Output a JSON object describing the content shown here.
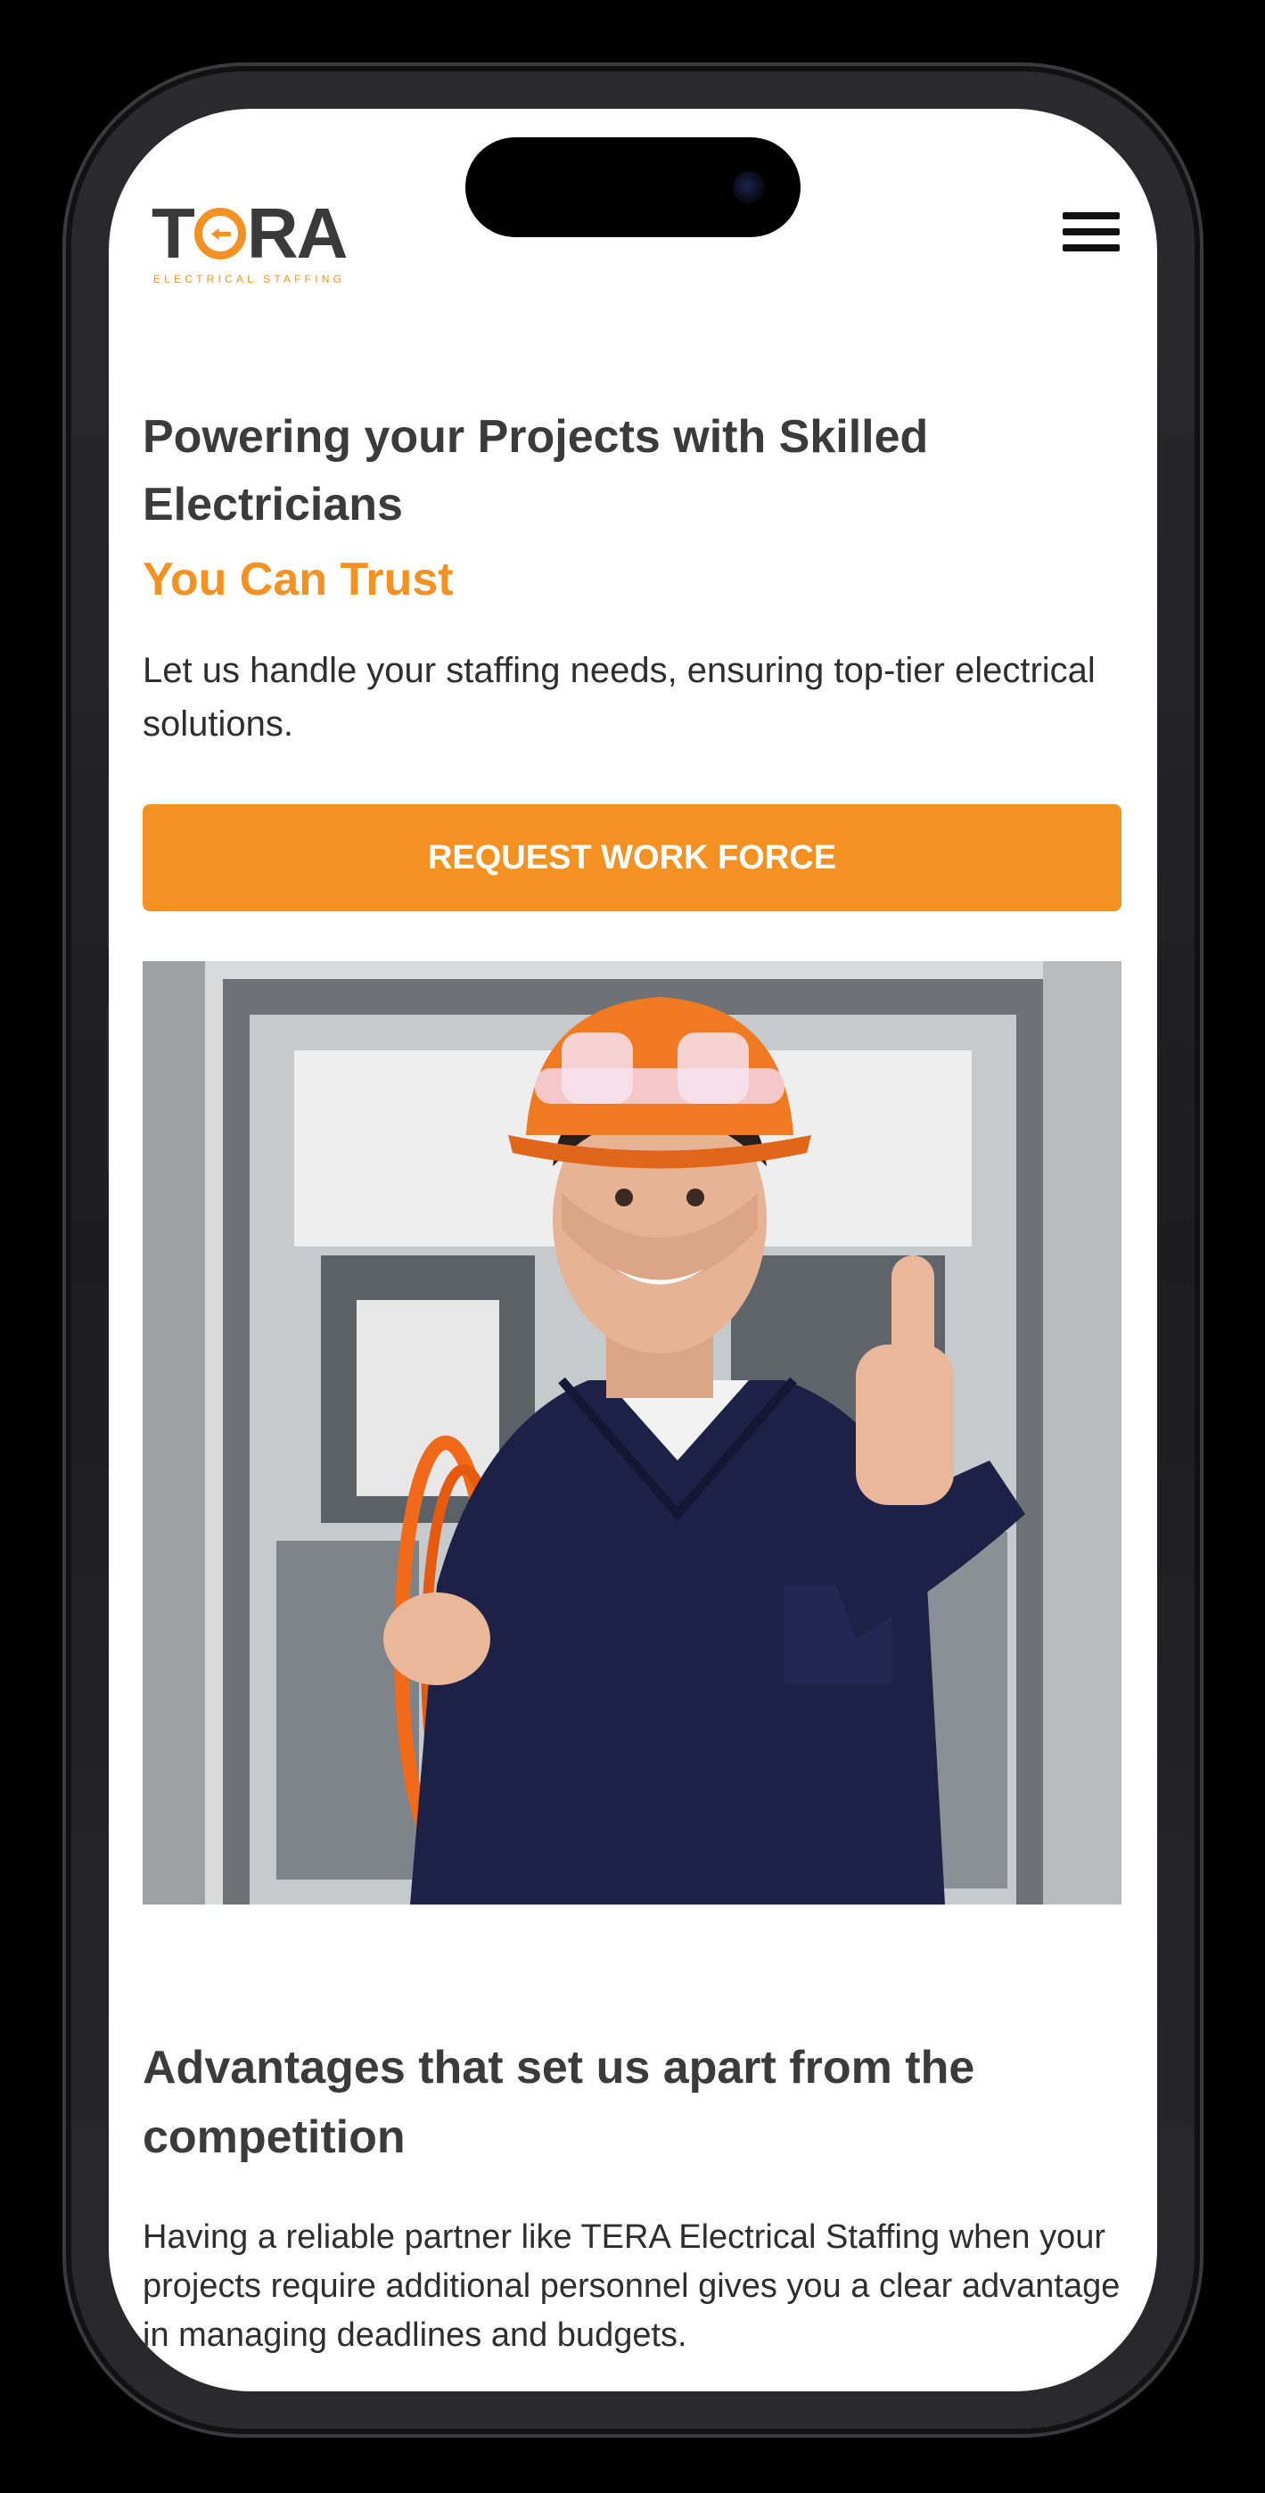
{
  "header": {
    "logo_wordmark_1": "T",
    "logo_wordmark_2": "RA",
    "logo_tagline": "ELECTRICAL STAFFING",
    "menu_icon": "hamburger-menu-icon"
  },
  "hero": {
    "title": "Powering your Projects with Skilled Electricians",
    "subtitle": "You Can Trust",
    "description": "Let us handle your staffing needs, ensuring top-tier electrical solutions.",
    "cta_label": "REQUEST WORK FORCE"
  },
  "photo": {
    "subject": "electrician-thumbs-up-photo"
  },
  "advantages": {
    "title": "Advantages that set us apart from the competition",
    "description": "Having a reliable partner like TERA Electrical Staffing when your projects require additional personnel gives you a clear advantage in managing deadlines and budgets."
  },
  "colors": {
    "accent": "#f39222",
    "heading": "#3b3b3b",
    "body_text": "#2e2e2e",
    "background": "#ffffff"
  }
}
